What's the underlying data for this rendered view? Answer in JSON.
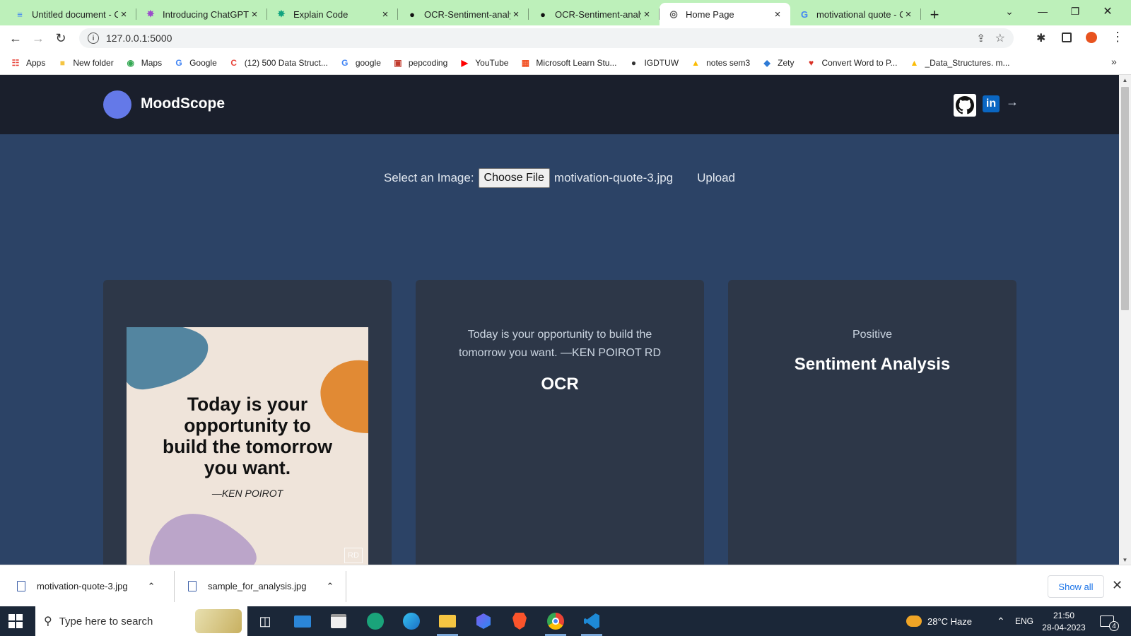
{
  "browser": {
    "tabs": [
      {
        "label": "Untitled document - C",
        "icon": "google-docs-icon",
        "color": "#4285f4",
        "active": false
      },
      {
        "label": "Introducing ChatGPT",
        "icon": "openai-icon",
        "color": "#9b4dca",
        "active": false
      },
      {
        "label": "Explain Code",
        "icon": "openai-icon",
        "color": "#10a37f",
        "active": false
      },
      {
        "label": "OCR-Sentiment-analy",
        "icon": "github-icon",
        "color": "#111111",
        "active": false
      },
      {
        "label": "OCR-Sentiment-analy",
        "icon": "github-icon",
        "color": "#111111",
        "active": false
      },
      {
        "label": "Home Page",
        "icon": "globe-icon",
        "color": "#555555",
        "active": true
      },
      {
        "label": "motivational quote - C",
        "icon": "google-icon",
        "color": "#4285f4",
        "active": false
      }
    ],
    "new_tab": "+",
    "address": "127.0.0.1:5000",
    "bookmarks": [
      {
        "label": "Apps",
        "icon": "apps-grid-icon"
      },
      {
        "label": "New folder",
        "icon": "folder-icon"
      },
      {
        "label": "Maps",
        "icon": "maps-pin-icon"
      },
      {
        "label": "Google",
        "icon": "google-icon"
      },
      {
        "label": "(12) 500 Data Struct...",
        "icon": "coding-ninjas-icon"
      },
      {
        "label": "google",
        "icon": "google-icon"
      },
      {
        "label": "pepcoding",
        "icon": "pepcoding-icon"
      },
      {
        "label": "YouTube",
        "icon": "youtube-icon"
      },
      {
        "label": "Microsoft Learn Stu...",
        "icon": "microsoft-icon"
      },
      {
        "label": "IGDTUW",
        "icon": "igdtuw-icon"
      },
      {
        "label": "notes sem3",
        "icon": "google-drive-icon"
      },
      {
        "label": "Zety",
        "icon": "zety-icon"
      },
      {
        "label": "Convert Word to P...",
        "icon": "heart-icon"
      },
      {
        "label": "_Data_Structures. m...",
        "icon": "google-drive-icon"
      }
    ]
  },
  "app": {
    "brand": "MoodScope",
    "upload": {
      "label": "Select an Image:",
      "choose_button": "Choose File",
      "filename": "motivation-quote-3.jpg",
      "submit": "Upload"
    },
    "image_card": {
      "quote_lines": [
        "Today is your",
        "opportunity to",
        "build the tomorrow",
        "you want."
      ],
      "author": "—KEN POIROT",
      "badge": "RD"
    },
    "ocr_card": {
      "text": "Today is your opportunity to build the tomorrow you want. —KEN POIROT RD",
      "title": "OCR"
    },
    "sentiment_card": {
      "text": "Positive",
      "title": "Sentiment Analysis"
    }
  },
  "downloads": {
    "items": [
      "motivation-quote-3.jpg",
      "sample_for_analysis.jpg"
    ],
    "show_all": "Show all"
  },
  "taskbar": {
    "search_placeholder": "Type here to search",
    "weather": "28°C  Haze",
    "language": "ENG",
    "time": "21:50",
    "date": "28-04-2023",
    "notifications": "4"
  },
  "colors": {
    "page_bg": "#2c4366",
    "navbar_bg": "#1a1f2c",
    "card_bg": "#2d3748",
    "brand_logo": "#6479e8",
    "tab_strip": "#bdf0ba"
  }
}
